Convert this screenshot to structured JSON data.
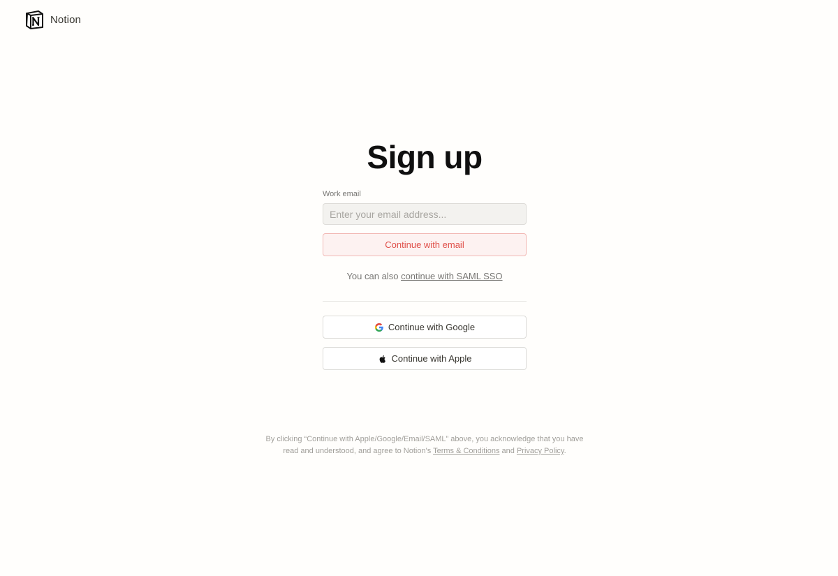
{
  "header": {
    "brand": "Notion",
    "logo_icon": "notion-logo-icon"
  },
  "signup": {
    "title": "Sign up",
    "email_label": "Work email",
    "email_placeholder": "Enter your email address...",
    "email_value": "",
    "continue_email_label": "Continue with email",
    "sso_prefix": "You can also",
    "sso_link": "continue with SAML SSO",
    "google_label": "Continue with Google",
    "google_icon": "google-icon",
    "apple_label": "Continue with Apple",
    "apple_icon": "apple-icon"
  },
  "legal": {
    "text_1": "By clicking “Continue with Apple/Google/Email/SAML” above, you acknowledge that you have read and understood, and agree to Notion's",
    "terms_link": "Terms & Conditions",
    "and": "and",
    "privacy_link": "Privacy Policy",
    "end": "."
  },
  "colors": {
    "background": "#fffefc",
    "email_button_bg": "#fdf2f1",
    "email_button_border": "#f2b9b5",
    "email_button_text": "#e0504a"
  }
}
